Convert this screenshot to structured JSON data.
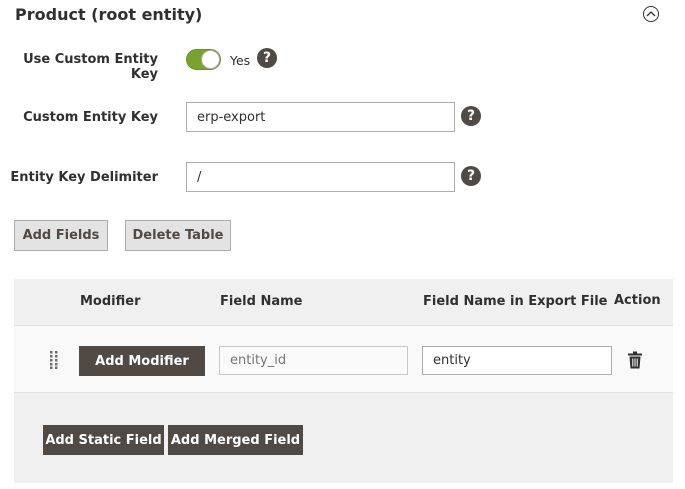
{
  "section": {
    "title": "Product (root entity)",
    "collapse_icon": "chevron-up-circle-icon"
  },
  "fields": {
    "use_custom_key": {
      "label": "Use Custom Entity Key",
      "toggle_state": "on",
      "toggle_text": "Yes",
      "toggle_color": "#79a22e"
    },
    "custom_key": {
      "label": "Custom Entity Key",
      "value": "erp-export"
    },
    "delimiter": {
      "label": "Entity Key Delimiter",
      "value": "/"
    },
    "help_icon_glyph": "?"
  },
  "actions": {
    "add_fields": "Add Fields",
    "delete_table": "Delete Table"
  },
  "table": {
    "columns": [
      "Modifier",
      "Field Name",
      "Field Name in Export File",
      "Action"
    ],
    "rows": [
      {
        "modifier_button": "Add Modifier",
        "field_name_placeholder": "entity_id",
        "export_name": "entity",
        "action_icon": "trash-icon"
      }
    ],
    "footer_buttons": {
      "add_static": "Add Static Field",
      "add_merged": "Add Merged Field"
    }
  }
}
